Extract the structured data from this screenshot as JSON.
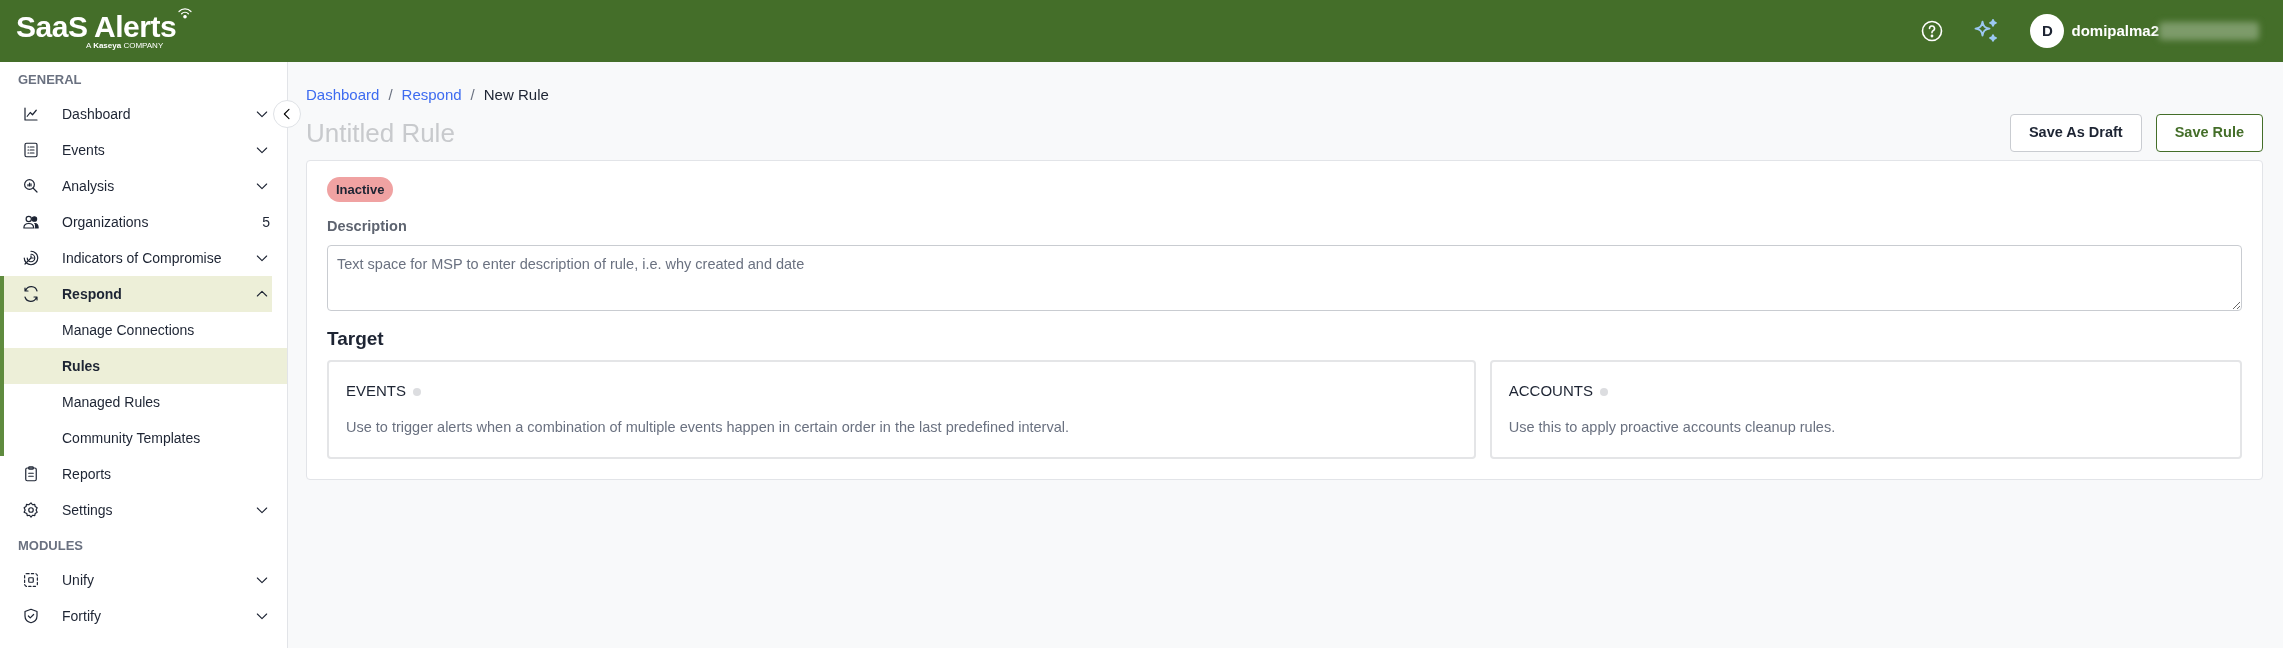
{
  "header": {
    "brand": "SaaS Alerts",
    "tagline": "A **Kaseya** COMPANY",
    "user": {
      "initial": "D",
      "name": "domipalma2"
    }
  },
  "sidebar": {
    "sections": [
      {
        "title": "GENERAL",
        "items": [
          {
            "label": "Dashboard",
            "expanded": false,
            "selected": false
          },
          {
            "label": "Events",
            "expanded": false,
            "selected": false
          },
          {
            "label": "Analysis",
            "expanded": false,
            "selected": false
          },
          {
            "label": "Organizations",
            "count": "5",
            "selected": false
          },
          {
            "label": "Indicators of Compromise",
            "expanded": false,
            "selected": false
          },
          {
            "label": "Respond",
            "expanded": true,
            "selected": true,
            "children": [
              {
                "label": "Manage Connections",
                "selected": false
              },
              {
                "label": "Rules",
                "selected": true
              },
              {
                "label": "Managed Rules",
                "selected": false
              },
              {
                "label": "Community Templates",
                "selected": false
              }
            ]
          },
          {
            "label": "Reports",
            "selected": false
          },
          {
            "label": "Settings",
            "expanded": false,
            "selected": false
          }
        ]
      },
      {
        "title": "MODULES",
        "items": [
          {
            "label": "Unify",
            "expanded": false,
            "selected": false
          },
          {
            "label": "Fortify",
            "expanded": false,
            "selected": false
          }
        ]
      }
    ]
  },
  "breadcrumb": [
    {
      "label": "Dashboard",
      "link": true
    },
    {
      "separator": "/",
      "label": "Respond",
      "link": true
    },
    {
      "separator": "/",
      "label": "New Rule",
      "link": false
    }
  ],
  "buttons": [
    {
      "label": "Save As Draft",
      "kind": "secondary"
    },
    {
      "label": "Save Rule",
      "kind": "primary"
    }
  ],
  "rule": {
    "title_placeholder": "Untitled Rule",
    "status": {
      "label": "Inactive",
      "active": false
    },
    "description_label": "Description",
    "description_placeholder": "Text space for MSP to enter description of rule, i.e. why created and date",
    "target_heading": "Target",
    "targets": [
      {
        "title": "EVENTS",
        "description": "Use to trigger alerts when a combination of multiple events happen in certain order in the last predefined interval.",
        "selected": false
      },
      {
        "title": "ACCOUNTS",
        "description": "Use this to apply proactive accounts cleanup rules.",
        "selected": false
      }
    ]
  }
}
